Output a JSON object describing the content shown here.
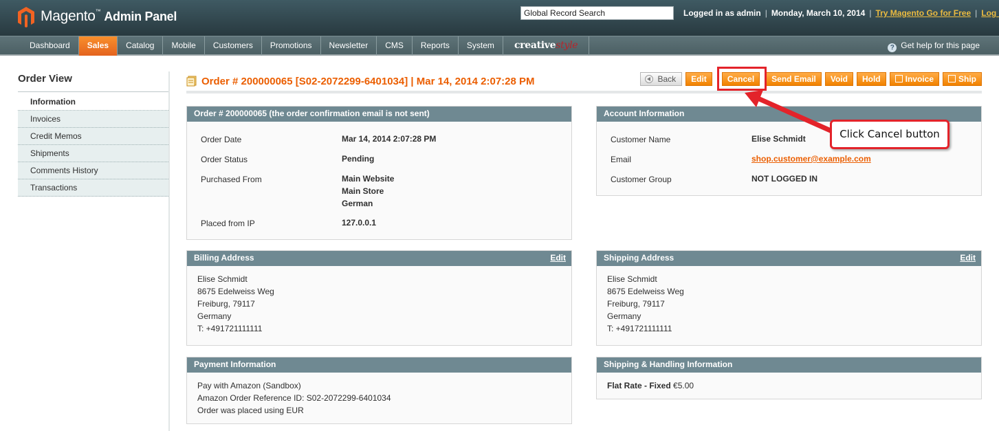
{
  "header": {
    "logo_brand": "Magento",
    "logo_tm": "™",
    "logo_sub": "Admin Panel",
    "search_value": "Global Record Search",
    "logged_in": "Logged in as admin",
    "date": "Monday, March 10, 2014",
    "try_link": "Try Magento Go for Free",
    "logout_link": "Log Out",
    "separator": "|"
  },
  "nav": {
    "items": [
      {
        "label": "Dashboard"
      },
      {
        "label": "Sales"
      },
      {
        "label": "Catalog"
      },
      {
        "label": "Mobile"
      },
      {
        "label": "Customers"
      },
      {
        "label": "Promotions"
      },
      {
        "label": "Newsletter"
      },
      {
        "label": "CMS"
      },
      {
        "label": "Reports"
      },
      {
        "label": "System"
      }
    ],
    "creative_a": "creative",
    "creative_b": "style",
    "help": "Get help for this page",
    "help_icon": "?"
  },
  "sidebar": {
    "title": "Order View",
    "tabs": [
      {
        "label": "Information"
      },
      {
        "label": "Invoices"
      },
      {
        "label": "Credit Memos"
      },
      {
        "label": "Shipments"
      },
      {
        "label": "Comments History"
      },
      {
        "label": "Transactions"
      }
    ]
  },
  "content": {
    "title": "Order # 200000065 [S02-2072299-6401034] | Mar 14, 2014 2:07:28 PM",
    "buttons": {
      "back": "Back",
      "edit": "Edit",
      "cancel": "Cancel",
      "send_email": "Send Email",
      "void": "Void",
      "hold": "Hold",
      "invoice": "Invoice",
      "ship": "Ship"
    }
  },
  "order_box": {
    "title": "Order # 200000065 (the order confirmation email is not sent)",
    "order_date_label": "Order Date",
    "order_date": "Mar 14, 2014 2:07:28 PM",
    "status_label": "Order Status",
    "status": "Pending",
    "purchased_label": "Purchased From",
    "purchased_1": "Main Website",
    "purchased_2": "Main Store",
    "purchased_3": "German",
    "ip_label": "Placed from IP",
    "ip": "127.0.0.1"
  },
  "account_box": {
    "title": "Account Information",
    "name_label": "Customer Name",
    "name": "Elise Schmidt",
    "email_label": "Email",
    "email": "shop.customer@example.com",
    "group_label": "Customer Group",
    "group": "NOT LOGGED IN"
  },
  "billing_box": {
    "title": "Billing Address",
    "edit": "Edit",
    "lines": [
      "Elise Schmidt",
      "8675 Edelweiss Weg",
      "Freiburg, 79117",
      "Germany",
      "T: +491721111111"
    ]
  },
  "shipping_box": {
    "title": "Shipping Address",
    "edit": "Edit",
    "lines": [
      "Elise Schmidt",
      "8675 Edelweiss Weg",
      "Freiburg, 79117",
      "Germany",
      "T: +491721111111"
    ]
  },
  "payment_box": {
    "title": "Payment Information",
    "lines": [
      "Pay with Amazon (Sandbox)",
      "Amazon Order Reference ID: S02-2072299-6401034",
      "Order was placed using EUR"
    ]
  },
  "shipping_method_box": {
    "title": "Shipping & Handling Information",
    "method": "Flat Rate - Fixed",
    "price": "€5.00"
  },
  "callout": {
    "text": "Click Cancel button"
  },
  "colors": {
    "accent": "#eb5e00",
    "box_header": "#6f8992",
    "annotation": "#e3232a"
  }
}
